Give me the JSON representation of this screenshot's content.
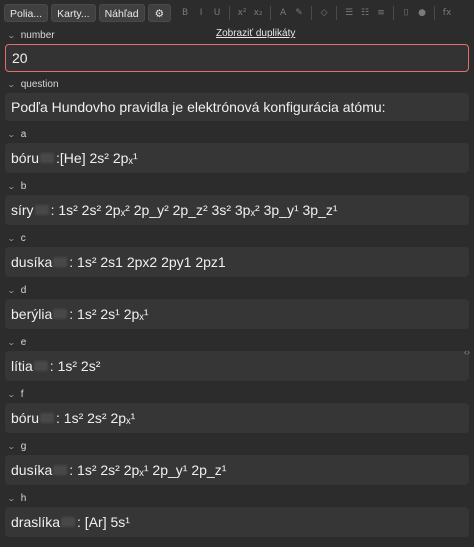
{
  "toolbar": {
    "fields_label": "Polia...",
    "cards_label": "Karty...",
    "preview_label": "Náhľad",
    "format_buttons": [
      {
        "name": "bold-icon",
        "glyph": "B"
      },
      {
        "name": "italic-icon",
        "glyph": "I"
      },
      {
        "name": "underline-icon",
        "glyph": "U"
      },
      {
        "name": "superscript-icon",
        "glyph": "x²"
      },
      {
        "name": "subscript-icon",
        "glyph": "x₂"
      },
      {
        "name": "text-color-icon",
        "glyph": "A"
      },
      {
        "name": "highlight-icon",
        "glyph": "✎"
      },
      {
        "name": "eraser-icon",
        "glyph": "◇"
      },
      {
        "name": "bullet-list-icon",
        "glyph": "☰"
      },
      {
        "name": "numbered-list-icon",
        "glyph": "☷"
      },
      {
        "name": "align-icon",
        "glyph": "≡"
      },
      {
        "name": "attach-icon",
        "glyph": "⌷"
      },
      {
        "name": "record-icon",
        "glyph": "●"
      },
      {
        "name": "formula-icon",
        "glyph": "fx"
      }
    ]
  },
  "duplicates_link": "Zobraziť duplikáty",
  "fields": [
    {
      "label": "number",
      "value": "20"
    },
    {
      "label": "question",
      "value": "Podľa Hundovho pravidla je elektrónová konfigurácia atómu:"
    },
    {
      "label": "a",
      "word": "bóru",
      "config": ":[He] 2s² 2pₓ¹"
    },
    {
      "label": "b",
      "word": "síry",
      "config": ": 1s² 2s² 2pₓ² 2p_y² 2p_z² 3s² 3pₓ² 3p_y¹ 3p_z¹"
    },
    {
      "label": "c",
      "word": "dusíka",
      "config": ": 1s² 2s1 2px2 2py1 2pz1"
    },
    {
      "label": "d",
      "word": "berýlia",
      "config": ": 1s² 2s¹ 2pₓ¹"
    },
    {
      "label": "e",
      "word": "lítia",
      "config": ": 1s² 2s²"
    },
    {
      "label": "f",
      "word": "bóru",
      "config": ": 1s² 2s² 2pₓ¹"
    },
    {
      "label": "g",
      "word": "dusíka",
      "config": ": 1s² 2s² 2pₓ¹ 2p_y¹ 2p_z¹"
    },
    {
      "label": "h",
      "word": "draslíka",
      "config": ": [Ar] 5s¹"
    }
  ],
  "side_arrows": "‹›"
}
